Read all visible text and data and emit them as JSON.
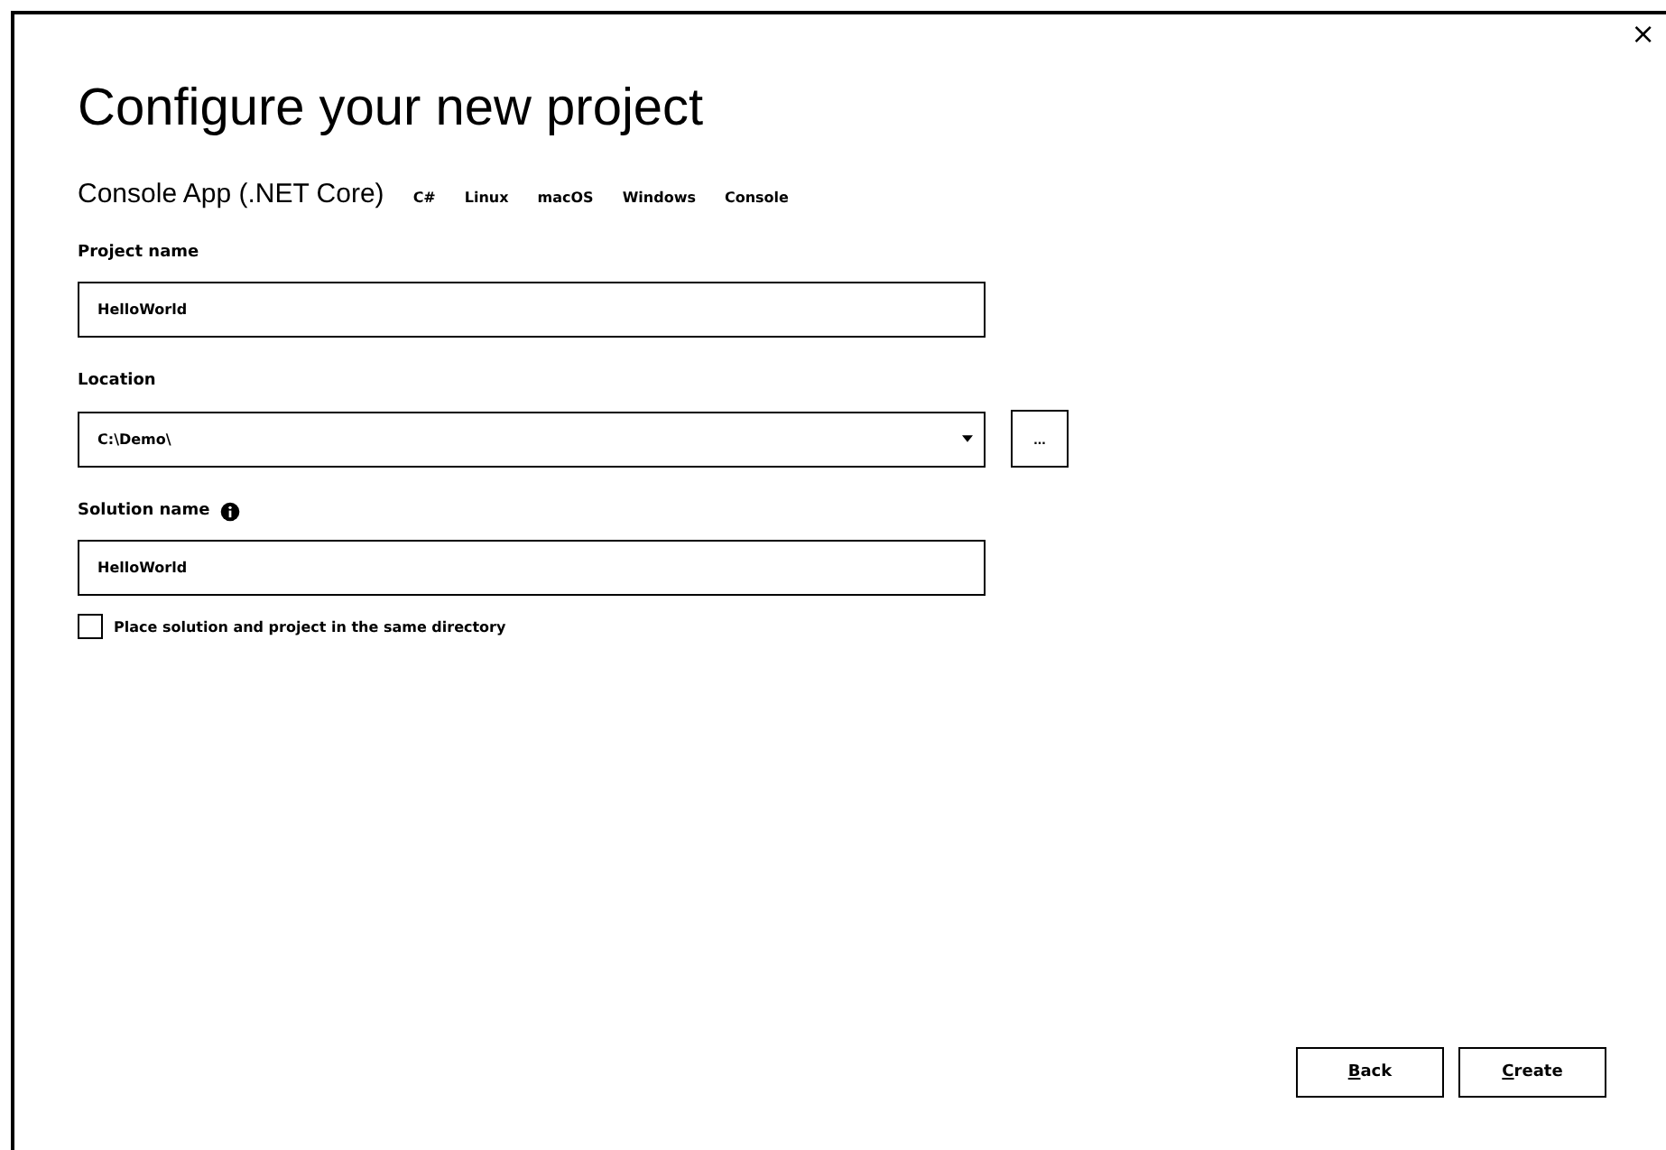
{
  "window": {
    "close": "×"
  },
  "title": "Configure your new project",
  "template": {
    "name": "Console App (.NET Core)",
    "tags": [
      "C#",
      "Linux",
      "macOS",
      "Windows",
      "Console"
    ]
  },
  "fields": [
    {
      "kind": "text",
      "label": "Project name",
      "value": "HelloWorld"
    },
    {
      "kind": "dropdown",
      "label": "Location",
      "value": "C:\\Demo\\",
      "browse": "..."
    },
    {
      "kind": "text",
      "label": "Solution name",
      "info": true,
      "value": "HelloWorld"
    }
  ],
  "checkbox": {
    "label": "Place solution and project in the same directory",
    "checked": false
  },
  "buttons": [
    "Back",
    "Create"
  ]
}
